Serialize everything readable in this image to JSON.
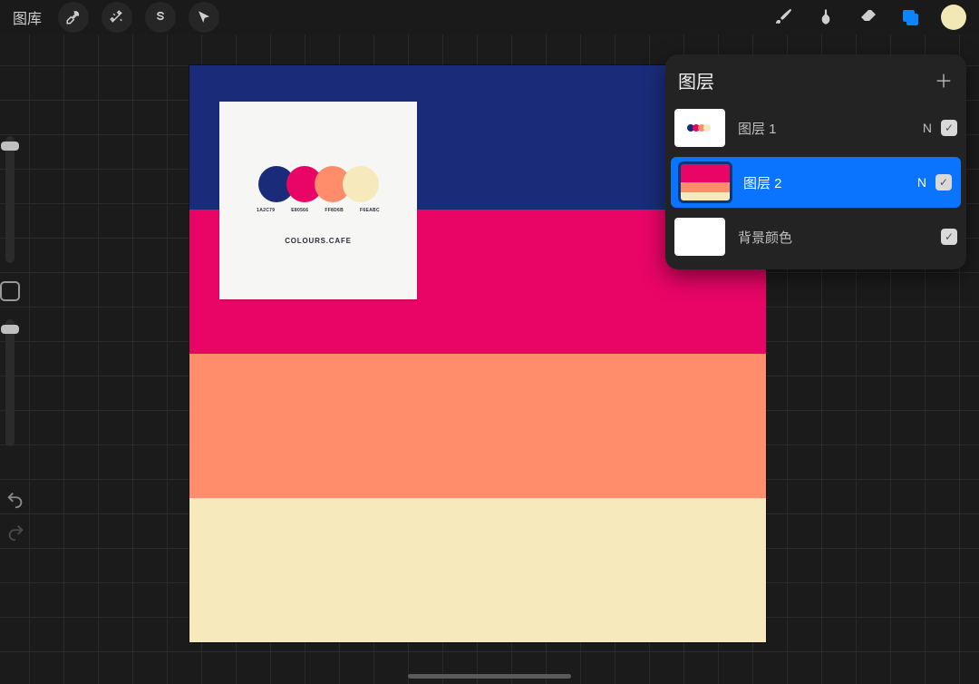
{
  "toolbar": {
    "gallery_label": "图库",
    "icons": {
      "wrench": "wrench-icon",
      "wand": "wand-icon",
      "select": "select-s-icon",
      "move": "cursor-icon",
      "brush": "brush-icon",
      "smudge": "smudge-icon",
      "eraser": "eraser-icon",
      "layers": "layers-icon",
      "color": "color-swatch"
    },
    "current_color": "#F2E8B6"
  },
  "palette": {
    "brand": "COLOURS.CAFE",
    "colors": [
      {
        "hex": "#1A2C79",
        "code": "1A2C79"
      },
      {
        "hex": "#E80566",
        "code": "E80566"
      },
      {
        "hex": "#FF8D6B",
        "code": "FF8D6B"
      },
      {
        "hex": "#F6EABC",
        "code": "F6EABC"
      }
    ]
  },
  "canvas": {
    "stripes": [
      "#1A2C79",
      "#E80566",
      "#FF8D6B",
      "#F6EABC"
    ]
  },
  "layers_panel": {
    "title": "图层",
    "layers": [
      {
        "name": "图层 1",
        "blend": "N",
        "visible": true,
        "selected": false,
        "thumb": "card"
      },
      {
        "name": "图层 2",
        "blend": "N",
        "visible": true,
        "selected": true,
        "thumb": "stripes"
      },
      {
        "name": "背景颜色",
        "blend": "",
        "visible": true,
        "selected": false,
        "thumb": "white"
      }
    ]
  }
}
